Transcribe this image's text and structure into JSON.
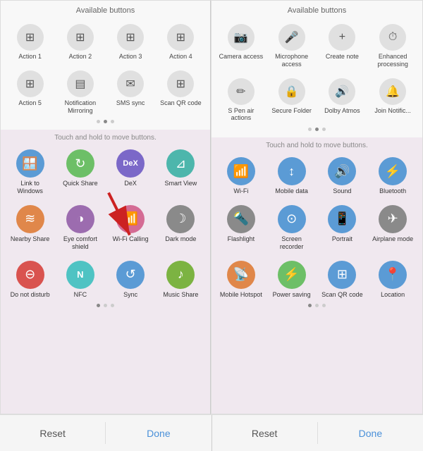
{
  "panels": [
    {
      "id": "left",
      "available_title": "Available buttons",
      "available_buttons": [
        {
          "label": "Action 1",
          "icon": "▦"
        },
        {
          "label": "Action 2",
          "icon": "▦"
        },
        {
          "label": "Action 3",
          "icon": "▦"
        },
        {
          "label": "Action 4",
          "icon": "▦"
        },
        {
          "label": "Action 5",
          "icon": "▦"
        },
        {
          "label": "Notification Mirroring",
          "icon": "▤"
        },
        {
          "label": "SMS sync",
          "icon": "✉"
        },
        {
          "label": "Scan QR code",
          "icon": "⊞"
        }
      ],
      "touch_hint": "Touch and hold to move buttons.",
      "active_buttons": [
        {
          "label": "Link to Windows",
          "icon": "🪟",
          "color": "icon-blue"
        },
        {
          "label": "Quick Share",
          "icon": "↻",
          "color": "icon-green"
        },
        {
          "label": "DeX",
          "icon": "⊡",
          "color": "icon-indigo"
        },
        {
          "label": "Smart View",
          "icon": "⊿",
          "color": "icon-teal"
        },
        {
          "label": "Nearby Share",
          "icon": "≋",
          "color": "icon-orange"
        },
        {
          "label": "Eye comfort shield",
          "icon": "◑",
          "color": "icon-purple"
        },
        {
          "label": "Wi-Fi Calling",
          "icon": "📶",
          "color": "icon-pink"
        },
        {
          "label": "Dark mode",
          "icon": "☽",
          "color": "icon-gray"
        },
        {
          "label": "Do not disturb",
          "icon": "⊖",
          "color": "icon-red"
        },
        {
          "label": "NFC",
          "icon": "ℕ",
          "color": "icon-cyan"
        },
        {
          "label": "Sync",
          "icon": "↺",
          "color": "icon-blue"
        },
        {
          "label": "Music Share",
          "icon": "♪",
          "color": "icon-lime"
        }
      ],
      "reset_label": "Reset",
      "done_label": "Done"
    },
    {
      "id": "right",
      "available_title": "Available buttons",
      "available_buttons": [
        {
          "label": "Camera access",
          "icon": "📷"
        },
        {
          "label": "Microphone access",
          "icon": "🎤"
        },
        {
          "label": "Create note",
          "icon": "+"
        },
        {
          "label": "Enhanced processing",
          "icon": "⏱"
        },
        {
          "label": "S Pen air actions",
          "icon": "✏"
        },
        {
          "label": "Secure Folder",
          "icon": "🔒"
        },
        {
          "label": "Dolby Atmos",
          "icon": "🔊"
        },
        {
          "label": "Join Notific...",
          "icon": "🔔"
        }
      ],
      "touch_hint": "Touch and hold to move buttons.",
      "active_buttons": [
        {
          "label": "Wi-Fi",
          "icon": "📶",
          "color": "icon-blue"
        },
        {
          "label": "Mobile data",
          "icon": "↕",
          "color": "icon-blue"
        },
        {
          "label": "Sound",
          "icon": "🔊",
          "color": "icon-blue"
        },
        {
          "label": "Bluetooth",
          "icon": "⚡",
          "color": "icon-blue"
        },
        {
          "label": "Flashlight",
          "icon": "🔦",
          "color": "icon-gray"
        },
        {
          "label": "Screen recorder",
          "icon": "⊙",
          "color": "icon-blue"
        },
        {
          "label": "Portrait",
          "icon": "📱",
          "color": "icon-blue"
        },
        {
          "label": "Airplane mode",
          "icon": "✈",
          "color": "icon-gray"
        },
        {
          "label": "Mobile Hotspot",
          "icon": "📡",
          "color": "icon-orange"
        },
        {
          "label": "Power saving",
          "icon": "⚡",
          "color": "icon-green"
        },
        {
          "label": "Scan QR code",
          "icon": "⊞",
          "color": "icon-blue"
        },
        {
          "label": "Location",
          "icon": "📍",
          "color": "icon-blue"
        }
      ],
      "reset_label": "Reset",
      "done_label": "Done"
    }
  ]
}
